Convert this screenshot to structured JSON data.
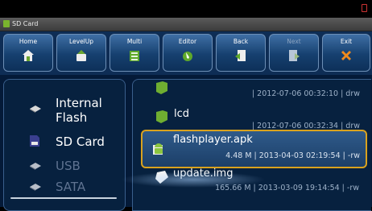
{
  "window": {
    "title": "SD Card"
  },
  "toolbar": {
    "buttons": [
      {
        "label": "Home",
        "icon": "home-icon",
        "enabled": true
      },
      {
        "label": "LevelUp",
        "icon": "level-up-icon",
        "enabled": true
      },
      {
        "label": "Multi",
        "icon": "multi-select-icon",
        "enabled": true
      },
      {
        "label": "Editor",
        "icon": "editor-icon",
        "enabled": true
      },
      {
        "label": "Back",
        "icon": "back-icon",
        "enabled": true
      },
      {
        "label": "Next",
        "icon": "next-icon",
        "enabled": false
      },
      {
        "label": "Exit",
        "icon": "exit-icon",
        "enabled": true
      }
    ]
  },
  "storage": {
    "items": [
      {
        "label": "Internal Flash",
        "icon": "hdd-icon",
        "enabled": true
      },
      {
        "label": "SD Card",
        "icon": "sd-card-icon",
        "enabled": true
      },
      {
        "label": "USB",
        "icon": "usb-icon",
        "enabled": false
      },
      {
        "label": "SATA",
        "icon": "sata-icon",
        "enabled": false
      }
    ]
  },
  "files": [
    {
      "name": "",
      "meta": "| 2012-07-06 00:32:10 | drw",
      "icon": "folder-icon"
    },
    {
      "name": "lcd",
      "meta": "| 2012-07-06 00:32:34 | drw",
      "icon": "folder-icon"
    },
    {
      "name": "flashplayer.apk",
      "meta": "4.48 M | 2013-04-03 02:19:54 | -rw",
      "icon": "android-apk-icon",
      "selected": true
    },
    {
      "name": "update.img",
      "meta": "165.66 M | 2013-03-09 19:14:54 | -rw",
      "icon": "file-icon"
    }
  ],
  "colors": {
    "accent": "#d9a21e",
    "background": "#041a38",
    "toolbar": "#0e2d55"
  }
}
